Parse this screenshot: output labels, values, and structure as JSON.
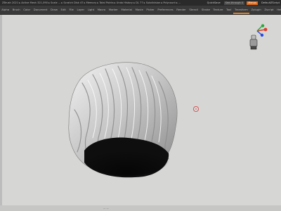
{
  "titlebar": {
    "status": "ZBrush 2021 ▸ Active Mesh 321,090 ▸ Scale ... ▸ Scratch Disk 47 ▸ Memory ▸ Total Points ▸ Undo History ▸ DL 77 ▸ Subdivision ▸ Polycount ▸ ...",
    "quicksave": "QuickSave",
    "seethrough": "See-through 0",
    "menus": "Menus",
    "default_zscript": "DefaultZScript"
  },
  "menubar": {
    "items": [
      "Alpha",
      "Brush",
      "Color",
      "Document",
      "Draw",
      "Edit",
      "File",
      "Layer",
      "Light",
      "Macro",
      "Marker",
      "Material",
      "Movie",
      "Picker",
      "Preferences",
      "Render",
      "Stencil",
      "Stroke",
      "Texture",
      "Tool",
      "Transform",
      "Zplugin",
      "Zscript",
      "Help"
    ],
    "active_index": 20
  },
  "canvas": {
    "background": "#d6d6d4",
    "mesh": "hair-sculpt",
    "gizmo_axes": {
      "x": "#e03a2a",
      "y": "#2aa83a",
      "z": "#2a4ae0"
    }
  },
  "bottombar": {
    "label": "— —"
  }
}
